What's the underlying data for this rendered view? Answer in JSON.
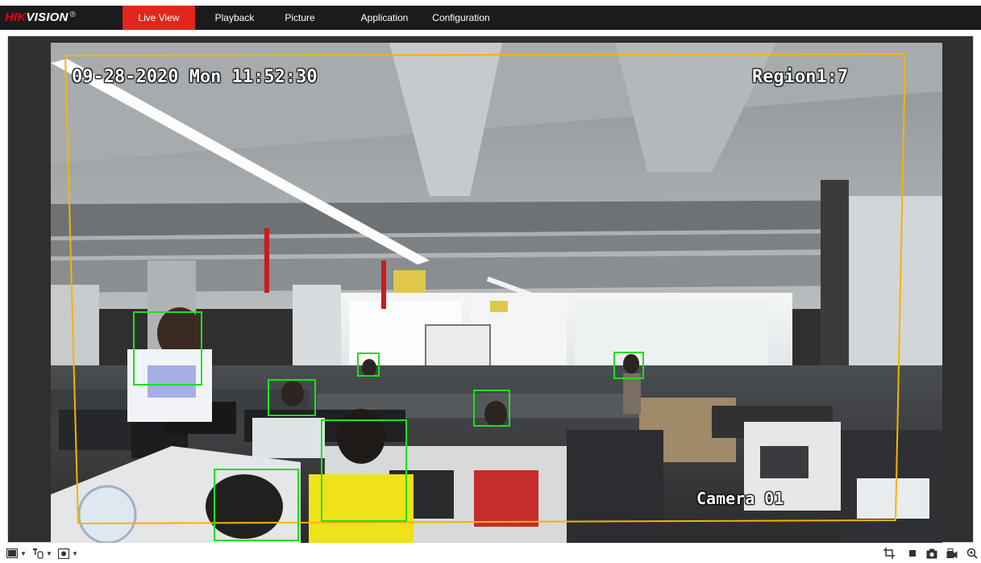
{
  "brand": {
    "logo_red": "HIK",
    "logo_white": "VISION",
    "logo_mark": "®"
  },
  "nav": {
    "tabs": [
      {
        "label": "Live View",
        "active": true
      },
      {
        "label": "Playback",
        "active": false
      },
      {
        "label": "Picture",
        "active": false
      },
      {
        "label": "Application",
        "active": false
      },
      {
        "label": "Configuration",
        "active": false
      }
    ]
  },
  "video": {
    "osd_timestamp": "09-28-2020 Mon 11:52:30",
    "osd_region": "Region1:7",
    "osd_camera": "Camera 01",
    "region_color": "#f5b400",
    "detection_color": "#1ee01e",
    "detection_count": 7
  },
  "toolbar": {
    "left_icons": [
      "window-layout-icon",
      "stream-type-icon",
      "plugin-icon"
    ],
    "right_icons": [
      "digital-zoom-crop-icon",
      "stop-all-icon",
      "capture-icon",
      "record-icon",
      "zoom-in-icon"
    ]
  },
  "colors": {
    "active_tab": "#e1261c",
    "nav_bg": "#1b1b1b",
    "viewer_bg": "#2f2f2f"
  }
}
